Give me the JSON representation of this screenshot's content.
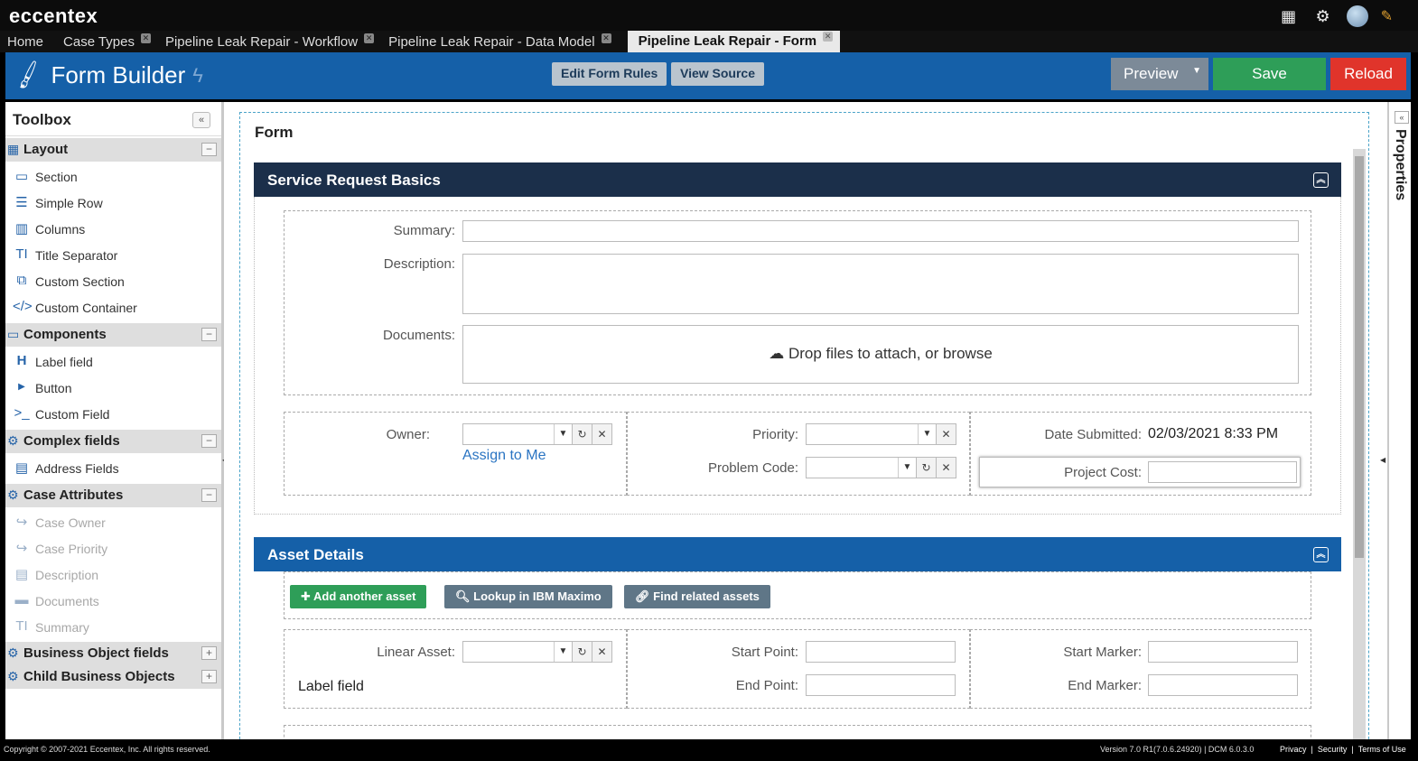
{
  "brand": "eccentex",
  "tabs": [
    {
      "label": "Home"
    },
    {
      "label": "Case Types"
    },
    {
      "label": "Pipeline Leak Repair - Workflow"
    },
    {
      "label": "Pipeline Leak Repair - Data Model"
    },
    {
      "label": "Pipeline Leak Repair - Form"
    }
  ],
  "header": {
    "title": "Form Builder",
    "edit_rules": "Edit Form Rules",
    "view_source": "View Source",
    "preview": "Preview",
    "save": "Save",
    "reload": "Reload"
  },
  "toolbox": {
    "title": "Toolbox",
    "groups": {
      "layout": {
        "label": "Layout",
        "items": [
          "Section",
          "Simple Row",
          "Columns",
          "Title Separator",
          "Custom Section",
          "Custom Container"
        ]
      },
      "components": {
        "label": "Components",
        "items": [
          "Label field",
          "Button",
          "Custom Field"
        ]
      },
      "complex": {
        "label": "Complex fields",
        "items": [
          "Address Fields"
        ]
      },
      "case_attributes": {
        "label": "Case Attributes",
        "items": [
          "Case Owner",
          "Case Priority",
          "Description",
          "Documents",
          "Summary"
        ]
      },
      "business_object": {
        "label": "Business Object fields"
      },
      "child_business": {
        "label": "Child Business Objects"
      }
    }
  },
  "form": {
    "title": "Form",
    "section1": {
      "title": "Service Request Basics",
      "summary_label": "Summary:",
      "description_label": "Description:",
      "documents_label": "Documents:",
      "drop_text": "Drop files to attach, or browse",
      "owner_label": "Owner:",
      "assign_link": "Assign to Me",
      "priority_label": "Priority:",
      "problem_code_label": "Problem Code:",
      "date_submitted_label": "Date Submitted:",
      "date_submitted_value": "02/03/2021 8:33 PM",
      "project_cost_label": "Project Cost:"
    },
    "section2": {
      "title": "Asset Details",
      "add_asset": "Add another asset",
      "lookup": "Lookup in IBM Maximo",
      "find_related": "Find related assets",
      "linear_asset_label": "Linear Asset:",
      "label_field": "Label field",
      "start_point_label": "Start Point:",
      "end_point_label": "End Point:",
      "start_marker_label": "Start Marker:",
      "end_marker_label": "End Marker:"
    }
  },
  "properties": {
    "label": "Properties"
  },
  "footer": {
    "copyright": "Copyright © 2007-2021 Eccentex, Inc. All rights reserved.",
    "version": "Version  7.0 R1(7.0.6.24920) | DCM 6.0.3.0",
    "privacy": "Privacy",
    "security": "Security",
    "terms": "Terms of Use"
  }
}
